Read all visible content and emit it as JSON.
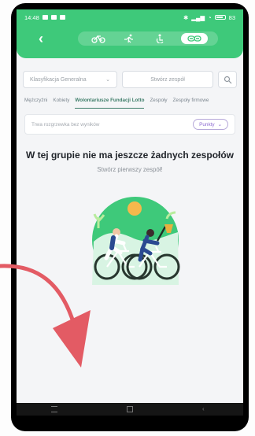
{
  "status": {
    "time": "14:48",
    "battery": "83"
  },
  "filters": {
    "classification": "Klasyfikacja Generalna",
    "team_placeholder": "Stwórz zespół"
  },
  "tabs": [
    {
      "label": "Mężczyźni"
    },
    {
      "label": "Kobiety"
    },
    {
      "label": "Wolontariusze Fundacji Lotto"
    },
    {
      "label": "Zespoły"
    },
    {
      "label": "Zespoły firmowe"
    }
  ],
  "filter_bar": {
    "note": "Trwa rozgrzewka bez wyników",
    "points_label": "Punkty"
  },
  "empty_state": {
    "title": "W tej grupie nie ma jeszcze żadnych zespołów",
    "subtitle": "Stwórz pierwszy zespół!"
  },
  "colors": {
    "header_green": "#3ec97a",
    "active_tab": "#3f7e6a",
    "points_purple": "#8d6bd1",
    "annotation_arrow": "#e35b64"
  }
}
